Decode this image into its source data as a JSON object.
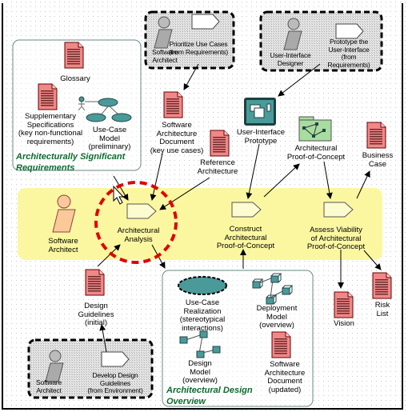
{
  "colors": {
    "band": "#fbf7a0",
    "doc": "#f08888",
    "highlight": "#e00000",
    "title_green": "#0b6b2c",
    "teal": "#4a9a9a",
    "folder": "#a8dca0"
  },
  "top_left_group": {
    "role": "Software\nArchitect",
    "activity": "Prioritize Use Cases\n(from Requirements)"
  },
  "top_right_group": {
    "role": "User-Interface\nDesigner",
    "activity": "Prototype the\nUser-Interface\n(from Requirements)"
  },
  "requirements_group": {
    "title": "Architecturally Significant\nRequirements",
    "glossary": "Glossary",
    "supplementary": "Supplementary\nSpecifications\n(key non-functional\nrequirements)",
    "use_case_model": "Use-Case\nModel\n(preliminary)"
  },
  "artifacts": {
    "sad": "Software\nArchitecture\nDocument\n(key use cases)",
    "reference_architecture": "Reference\nArchitecture",
    "ui_prototype": "User-Interface\nPrototype",
    "arch_poc": "Architectural\nProof-of-Concept",
    "business_case": "Business\nCase",
    "design_guidelines": "Design\nGuidelines\n(initial)",
    "vision": "Vision",
    "risk_list": "Risk List"
  },
  "band": {
    "role": "Software\nArchitect",
    "analysis": "Architectural\nAnalysis",
    "construct": "Construct\nArchitectural\nProof-of-Concept",
    "assess": "Assess Viability\nof Architectural\nProof-of-Concept"
  },
  "design_group": {
    "title": "Architectural Design\nOverview",
    "use_case_realization": "Use-Case\nRealization\n(stereotypical\ninteractions)",
    "deployment_model": "Deployment\nModel\n(overview)",
    "design_model": "Design\nModel\n(overview)",
    "sad_updated": "Software\nArchitecture\nDocument\n(updated)"
  },
  "bottom_left_group": {
    "role": "Software\nArchitect",
    "activity": "Develop Design\nGuidelines\n(from Environment)"
  }
}
